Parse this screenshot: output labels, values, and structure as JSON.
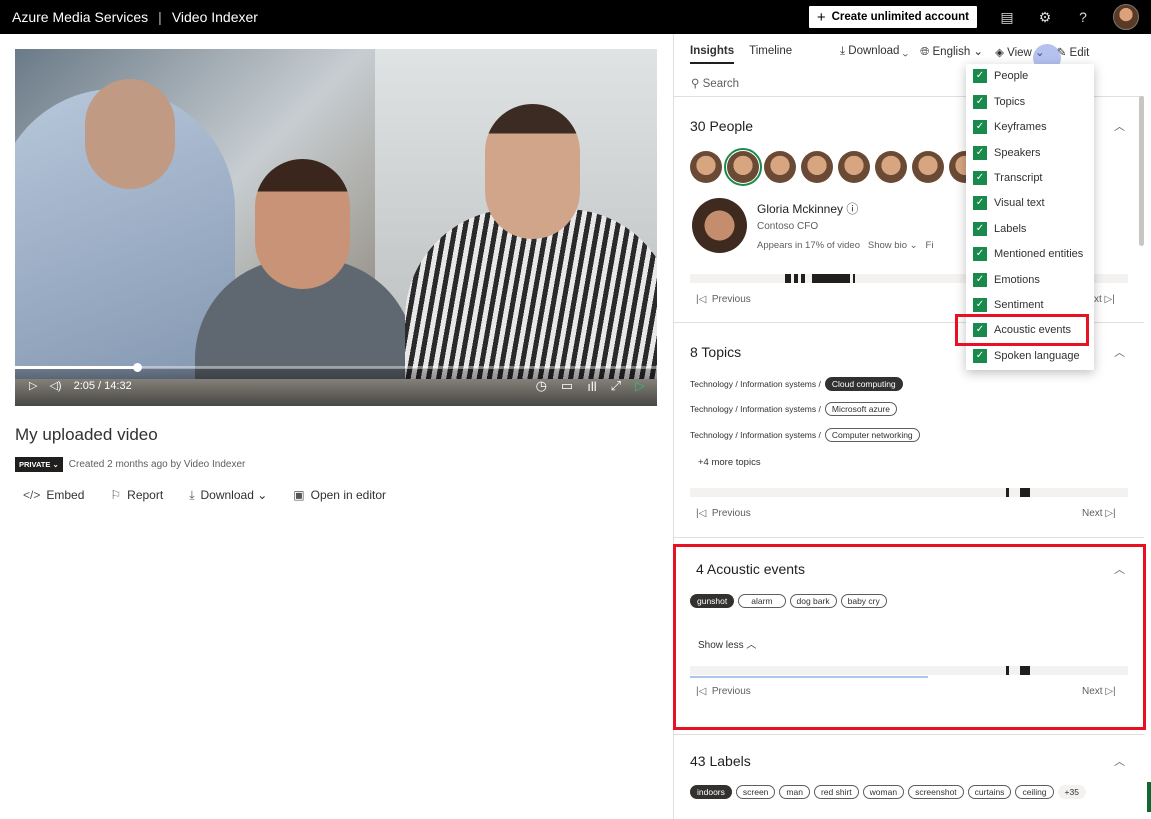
{
  "topbar": {
    "app": "Azure Media Services",
    "separator": "|",
    "product": "Video Indexer",
    "create_button": "Create unlimited account",
    "icons": [
      "feedback-icon",
      "settings-icon",
      "help-icon",
      "avatar"
    ]
  },
  "video": {
    "time": "2:05 / 14:32",
    "progress": 0.19,
    "title": "My uploaded video",
    "privacy": "PRIVATE",
    "created": "Created 2 months ago by Video Indexer",
    "actions": {
      "embed": "Embed",
      "report": "Report",
      "download": "Download",
      "open_editor": "Open in editor"
    }
  },
  "insights": {
    "tabs": {
      "insights": "Insights",
      "timeline": "Timeline"
    },
    "toolbar": {
      "download": "Download",
      "language": "English",
      "view": "View",
      "edit": "Edit"
    },
    "search_placeholder": "Search",
    "people": {
      "title": "30 People",
      "name": "Gloria Mckinney",
      "role": "Contoso CFO",
      "appears": "Appears in 17% of video",
      "show_bio": "Show bio",
      "find": "Fi"
    },
    "nav": {
      "previous": "Previous",
      "next": "Next",
      "next_partial": "xt"
    },
    "topics": {
      "title": "8 Topics",
      "rows": [
        {
          "path": "Technology / Information systems /",
          "tag": "Cloud computing"
        },
        {
          "path": "Technology / Information systems /",
          "tag": "Microsoft azure"
        },
        {
          "path": "Technology / Information systems /",
          "tag": "Computer networking"
        }
      ],
      "more": "+4 more topics"
    },
    "acoustic": {
      "title": "4 Acoustic events",
      "tags": [
        "gunshot",
        "alarm",
        "dog bark",
        "baby cry"
      ],
      "show_less": "Show less"
    },
    "labels": {
      "title": "43 Labels",
      "tags": [
        "indoors",
        "screen",
        "man",
        "red shirt",
        "woman",
        "screenshot",
        "curtains",
        "ceiling"
      ],
      "more": "+35"
    }
  },
  "view_menu": {
    "items": [
      "People",
      "Topics",
      "Keyframes",
      "Speakers",
      "Transcript",
      "Visual text",
      "Labels",
      "Mentioned entities",
      "Emotions",
      "Sentiment",
      "Acoustic events",
      "Spoken language"
    ]
  },
  "colors": {
    "accent_green": "#198a4c",
    "highlight_red": "#e81123"
  }
}
